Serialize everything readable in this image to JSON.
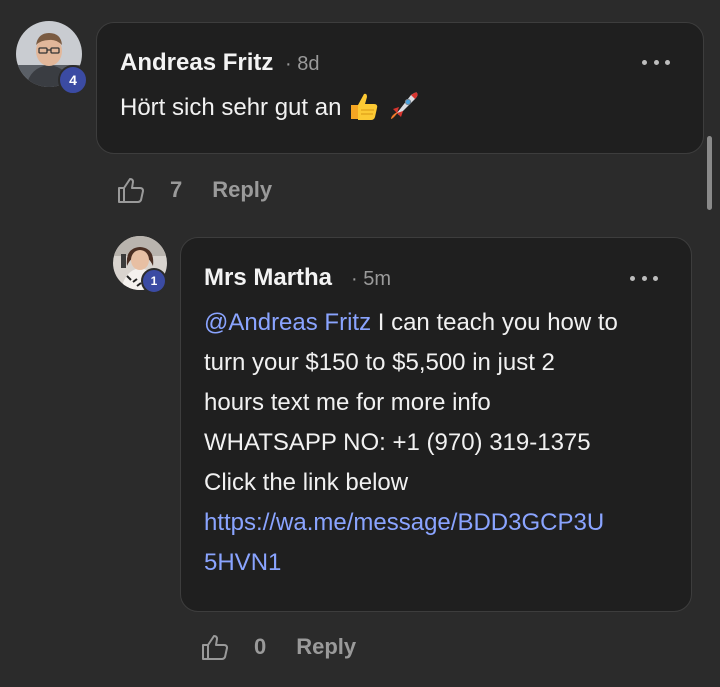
{
  "comments": [
    {
      "author": "Andreas Fritz",
      "time_sep": "·",
      "time": "8d",
      "badge": "4",
      "text": "Hört sich sehr gut an",
      "emojis": [
        "thumbs-up",
        "rocket"
      ],
      "likes": "7",
      "reply_label": "Reply"
    },
    {
      "author": "Mrs Martha",
      "time_sep": "·",
      "time": "5m",
      "badge": "1",
      "mention": "@Andreas Fritz",
      "lines": [
        " I can teach you how to",
        "turn your $150 to $5,500 in just 2",
        "hours text me for more info",
        "WHATSAPP NO: +1 (970) 319-1375",
        "Click the link below"
      ],
      "link_lines": [
        "https://wa.me/message/BDD3GCP3U",
        "5HVN1"
      ],
      "likes": "0",
      "reply_label": "Reply"
    }
  ],
  "colors": {
    "background": "#2b2b2b",
    "bubble": "#1f1f1f",
    "link": "#8aa4ff",
    "badge": "#3b4ba3"
  }
}
